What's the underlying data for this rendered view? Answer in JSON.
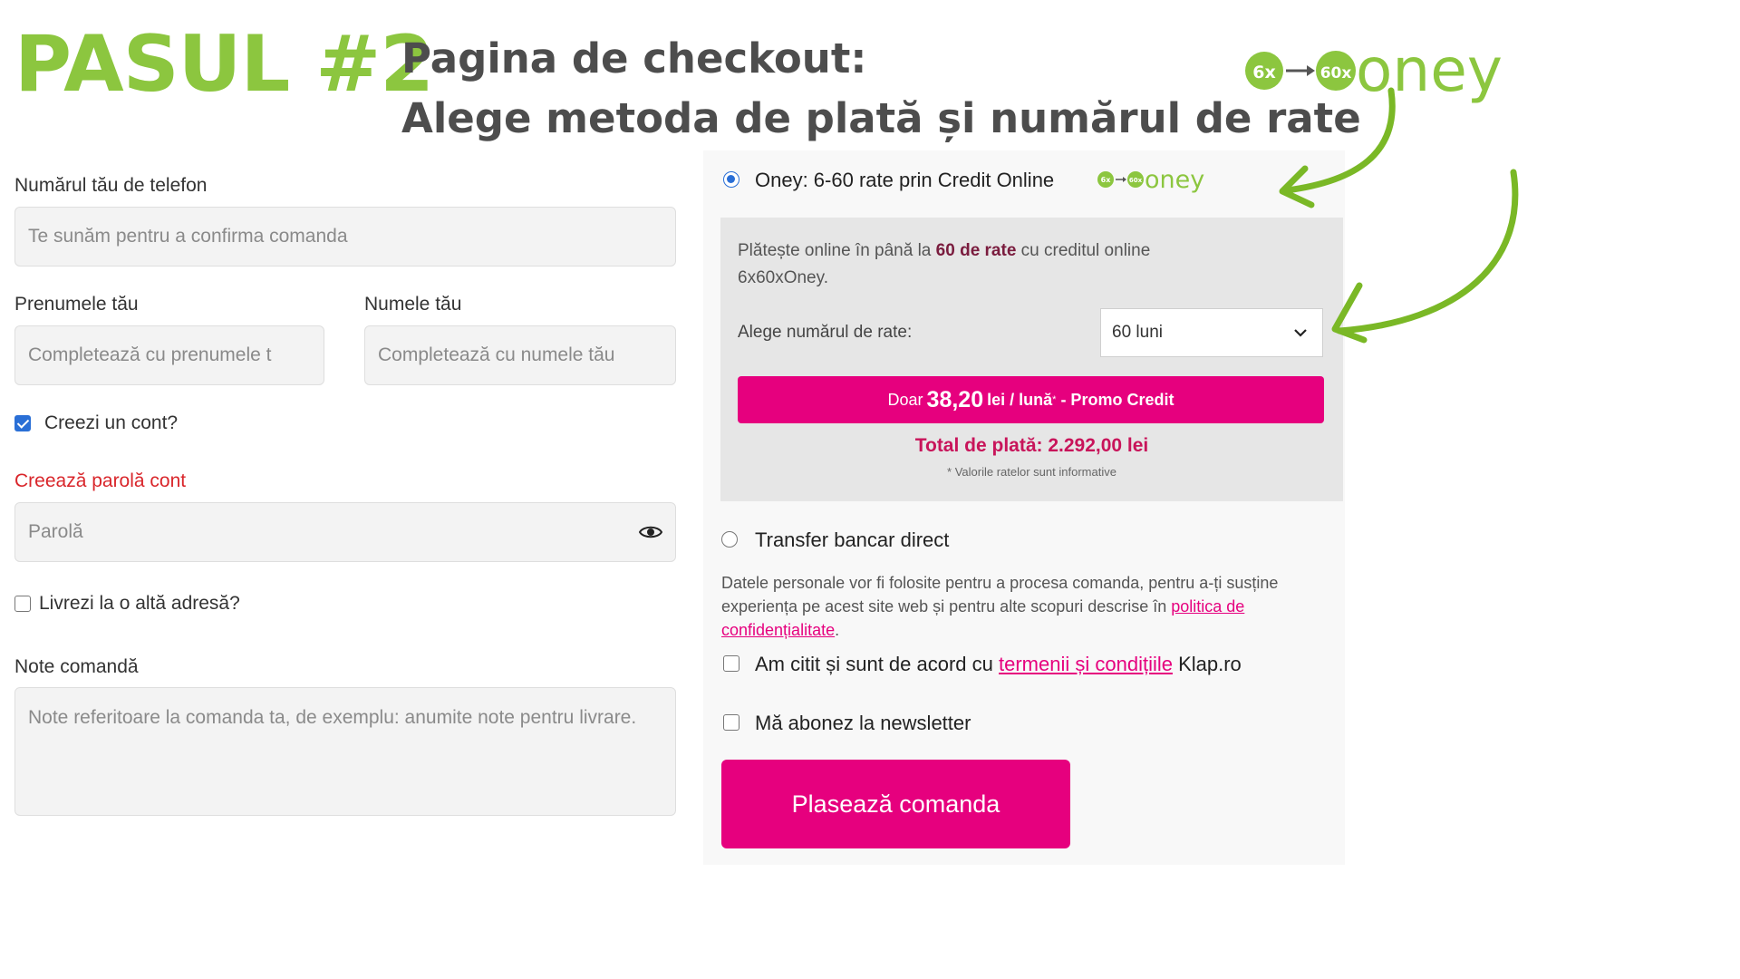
{
  "header": {
    "step": "PASUL #2",
    "line1": "Pagina de checkout:",
    "line2": "Alege metoda de plată și numărul de rate",
    "logo": {
      "from": "6x",
      "to": "60x",
      "brand": "oney"
    }
  },
  "form": {
    "phone": {
      "label": "Numărul tău de telefon",
      "placeholder": "Te sunăm pentru a confirma comanda"
    },
    "first_name": {
      "label": "Prenumele tău",
      "placeholder": "Completează cu prenumele t"
    },
    "last_name": {
      "label": "Numele tău",
      "placeholder": "Completează cu numele tău"
    },
    "create_account": {
      "label": "Creezi un cont?",
      "checked": true
    },
    "password": {
      "label": "Creează parolă cont",
      "placeholder": "Parolă"
    },
    "ship_elsewhere": {
      "label": "Livrezi la o altă adresă?",
      "checked": false
    },
    "notes": {
      "label": "Note comandă",
      "placeholder": "Note referitoare la comanda ta, de exemplu: anumite note pentru livrare."
    }
  },
  "payment": {
    "oney": {
      "label": "Oney: 6-60 rate prin Credit Online",
      "selected": true,
      "desc_pre": "Plătește online în până la ",
      "desc_bold": "60 de rate",
      "desc_post": " cu creditul online 6x60xOney.",
      "rate_label": "Alege numărul de rate:",
      "rate_value": "60 luni",
      "promo": {
        "pre": "Doar",
        "amount": "38,20",
        "unit": "lei / lună",
        "mark": "*",
        "suffix": "- Promo Credit"
      },
      "total": "Total de plată: 2.292,00 lei",
      "disclaimer": "* Valorile ratelor sunt informative"
    },
    "bank": {
      "label": "Transfer bancar direct",
      "selected": false
    },
    "privacy": {
      "text": "Datele personale vor fi folosite pentru a procesa comanda, pentru a-ți susține experiența pe acest site web și pentru alte scopuri descrise în ",
      "link": "politica de confidențialitate",
      "end": "."
    },
    "terms": {
      "pre": "Am citit și sunt de acord cu ",
      "link": "termenii și condițiile",
      "post": " Klap.ro",
      "checked": false
    },
    "newsletter": {
      "label": "Mă abonez la newsletter",
      "checked": false
    },
    "submit": "Plasează comanda"
  },
  "colors": {
    "accent_green": "#8cc63f",
    "brand_pink": "#e6007e",
    "total_red": "#c8145a"
  }
}
